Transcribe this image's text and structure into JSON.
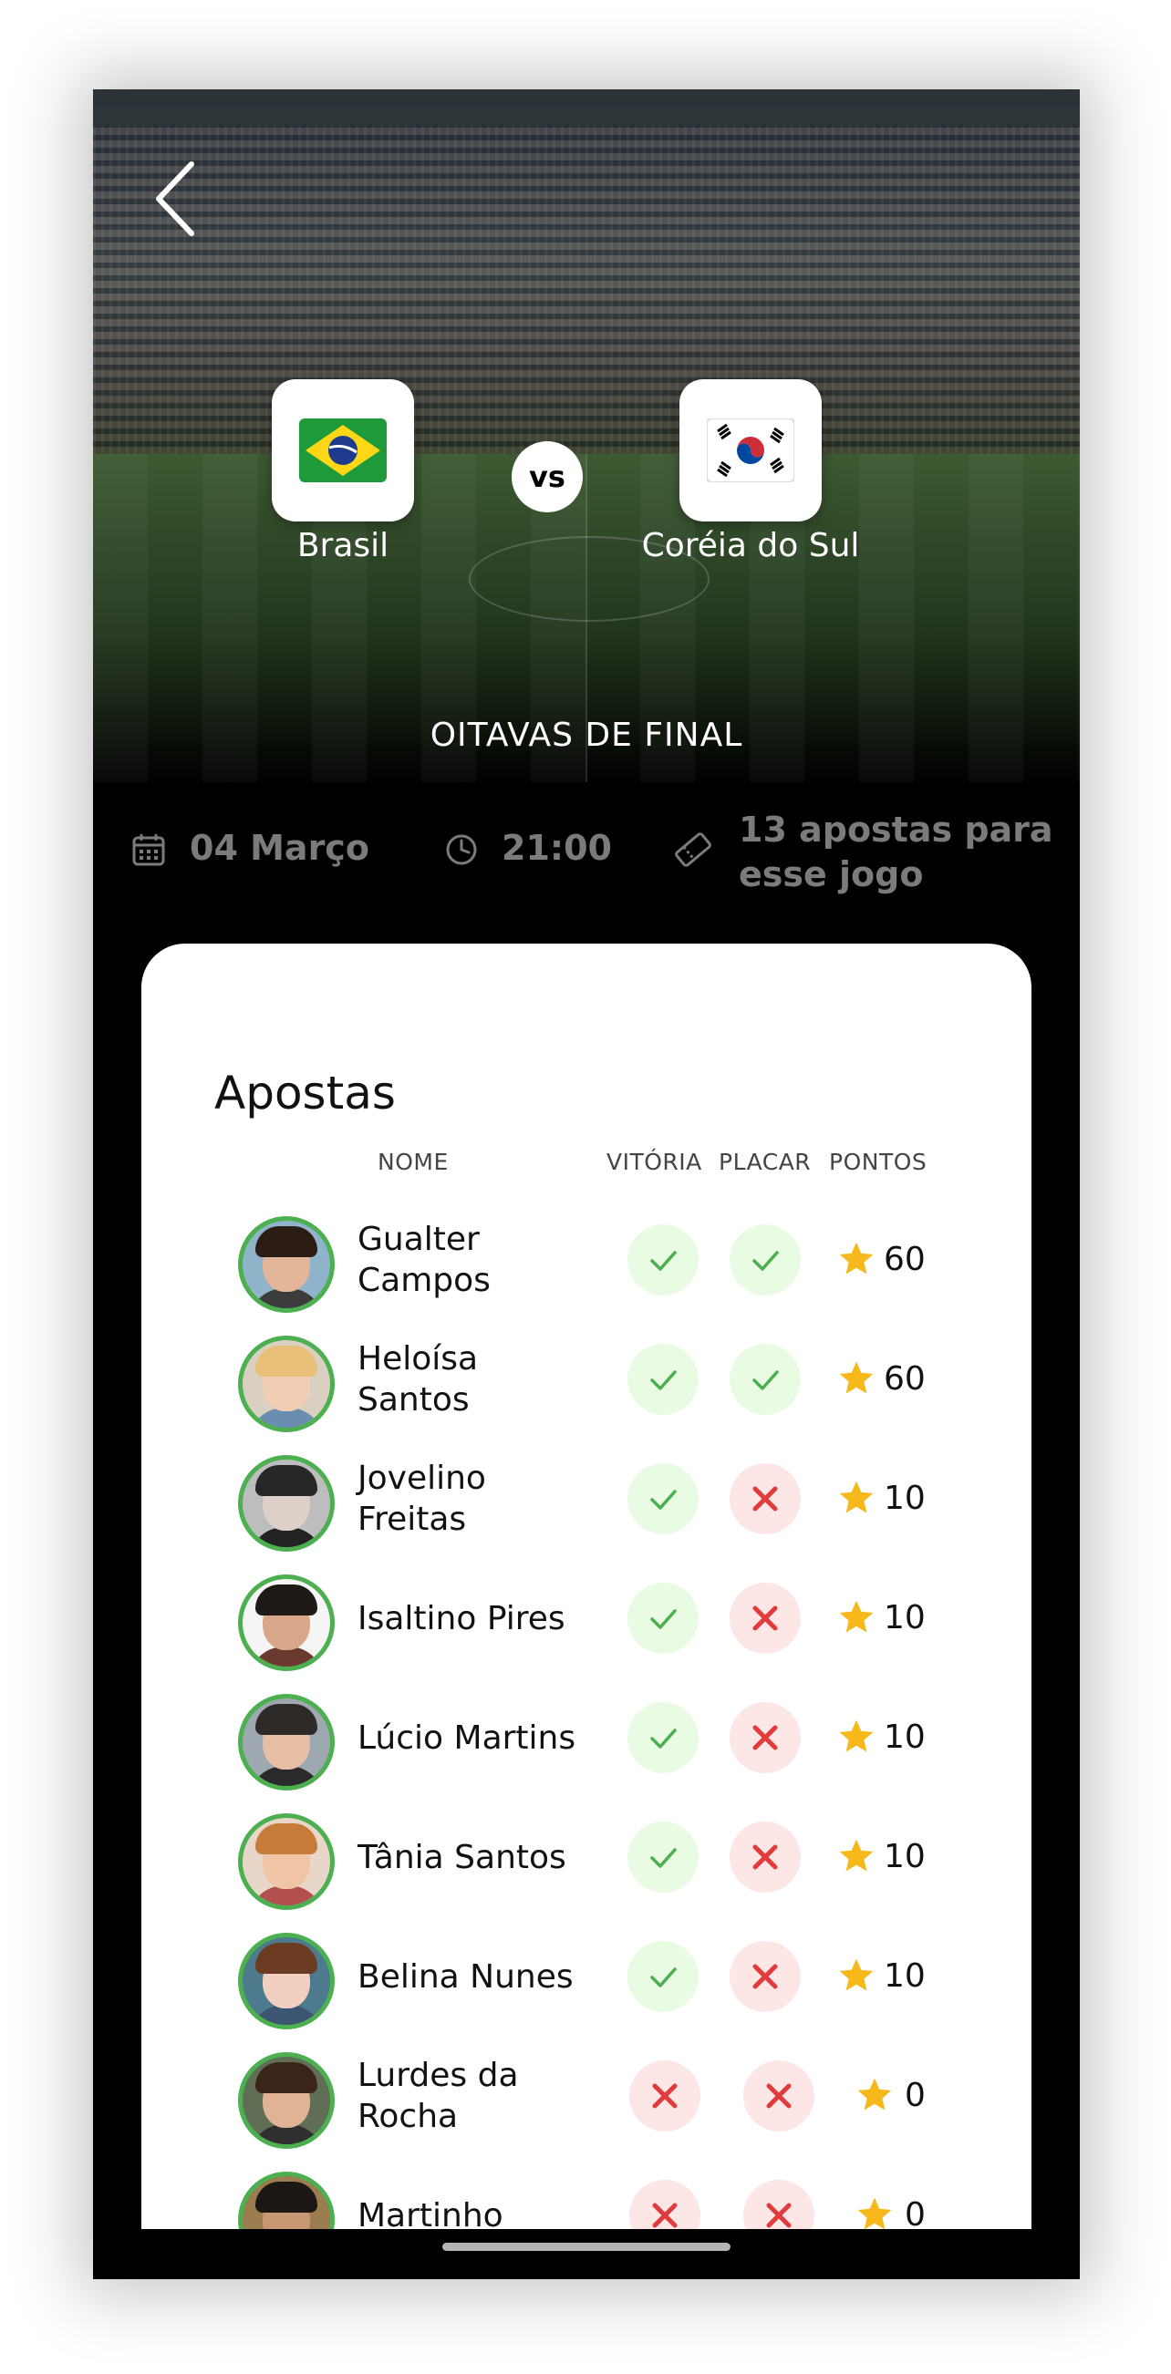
{
  "match": {
    "home_team": "Brasil",
    "away_team": "Coréia do Sul",
    "vs_label": "vs",
    "stage": "OITAVAS DE FINAL",
    "date": "04 Março",
    "time": "21:00",
    "bets_line1": "13 apostas para",
    "bets_line2": "esse jogo"
  },
  "bets": {
    "title": "Apostas",
    "columns": {
      "name": "NOME",
      "win": "VITÓRIA",
      "score": "PLACAR",
      "points": "PONTOS"
    },
    "rows": [
      {
        "name": "Gualter Campos",
        "win": true,
        "score": true,
        "points": "60"
      },
      {
        "name": "Heloísa Santos",
        "win": true,
        "score": true,
        "points": "60"
      },
      {
        "name": "Jovelino Freitas",
        "win": true,
        "score": false,
        "points": "10"
      },
      {
        "name": "Isaltino Pires",
        "win": true,
        "score": false,
        "points": "10"
      },
      {
        "name": "Lúcio Martins",
        "win": true,
        "score": false,
        "points": "10"
      },
      {
        "name": "Tânia Santos",
        "win": true,
        "score": false,
        "points": "10"
      },
      {
        "name": "Belina Nunes",
        "win": true,
        "score": false,
        "points": "10"
      },
      {
        "name": "Lurdes da Rocha",
        "win": false,
        "score": false,
        "points": "0"
      },
      {
        "name": "Martinho",
        "win": false,
        "score": false,
        "points": "0"
      }
    ]
  },
  "colors": {
    "accent_green": "#4caf50",
    "check_green": "#4caf50",
    "cross_red": "#e23b3b",
    "star_yellow": "#f6b81a"
  }
}
